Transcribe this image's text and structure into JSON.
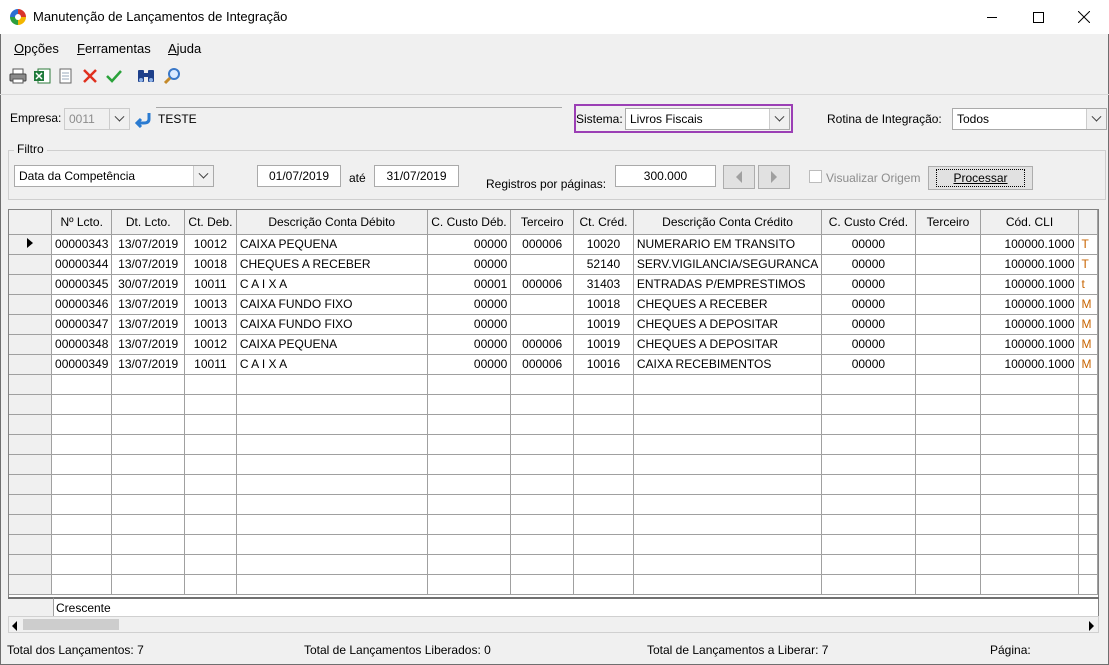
{
  "window": {
    "title": "Manutenção de Lançamentos de Integração"
  },
  "menu": [
    {
      "label": "Opções",
      "key": "O",
      "rest": "pções"
    },
    {
      "label": "Ferramentas",
      "key": "F",
      "rest": "erramentas"
    },
    {
      "label": "Ajuda",
      "key": "A",
      "rest": "juda"
    }
  ],
  "toolbar": {
    "icons": [
      "print-icon",
      "excel-export-icon",
      "document-icon",
      "cancel-x-icon",
      "confirm-check-icon",
      "binoculars-icon",
      "magnifier-icon"
    ]
  },
  "form": {
    "empresa_label": "Empresa:",
    "empresa_code": "0011",
    "empresa_name": "TESTE",
    "sistema_label": "Sistema:",
    "sistema_value": "Livros Fiscais",
    "rotina_label": "Rotina de Integração:",
    "rotina_value": "Todos",
    "highlight_color": "#9b3fb5"
  },
  "filtro": {
    "title": "Filtro",
    "type_value": "Data da Competência",
    "date_from": "01/07/2019",
    "ate_label": "até",
    "date_to": "31/07/2019",
    "registros_label": "Registros por páginas:",
    "registros_value": "300.000",
    "visualizar_label": "Visualizar Origem",
    "processar_label": "Processar"
  },
  "grid": {
    "columns": [
      "",
      "Nº Lcto.",
      "Dt. Lcto.",
      "Ct. Deb.",
      "Descrição Conta Débito",
      "C. Custo Déb.",
      "Terceiro",
      "Ct. Créd.",
      "Descrição Conta Crédito",
      "C. Custo Créd.",
      "Terceiro",
      "Cód. CLI",
      ""
    ],
    "rows": [
      [
        "00000343",
        "13/07/2019",
        "10012",
        "CAIXA PEQUENA",
        "00000",
        "000006",
        "10020",
        "NUMERARIO EM TRANSITO",
        "00000",
        "",
        "100000.1000",
        "T"
      ],
      [
        "00000344",
        "13/07/2019",
        "10018",
        "CHEQUES A RECEBER",
        "00000",
        "",
        "52140",
        "SERV.VIGILANCIA/SEGURANCA",
        "00000",
        "",
        "100000.1000",
        "T"
      ],
      [
        "00000345",
        "30/07/2019",
        "10011",
        "C A I X A",
        "00001",
        "000006",
        "31403",
        "ENTRADAS P/EMPRESTIMOS",
        "00000",
        "",
        "100000.1000",
        "t"
      ],
      [
        "00000346",
        "13/07/2019",
        "10013",
        "CAIXA FUNDO FIXO",
        "00000",
        "",
        "10018",
        "CHEQUES A RECEBER",
        "00000",
        "",
        "100000.1000",
        "M"
      ],
      [
        "00000347",
        "13/07/2019",
        "10013",
        "CAIXA FUNDO FIXO",
        "00000",
        "",
        "10019",
        "CHEQUES A DEPOSITAR",
        "00000",
        "",
        "100000.1000",
        "M"
      ],
      [
        "00000348",
        "13/07/2019",
        "10012",
        "CAIXA PEQUENA",
        "00000",
        "000006",
        "10019",
        "CHEQUES A DEPOSITAR",
        "00000",
        "",
        "100000.1000",
        "M"
      ],
      [
        "00000349",
        "13/07/2019",
        "10011",
        "C A I X A",
        "00000",
        "000006",
        "10016",
        "CAIXA RECEBIMENTOS",
        "00000",
        "",
        "100000.1000",
        "M"
      ]
    ],
    "footer_label": "Crescente"
  },
  "status": {
    "total_lancamentos": "Total dos Lançamentos: 7",
    "total_liberados": "Total de Lançamentos Liberados: 0",
    "total_a_liberar": "Total de Lançamentos a Liberar: 7",
    "pagina": "Página:"
  }
}
